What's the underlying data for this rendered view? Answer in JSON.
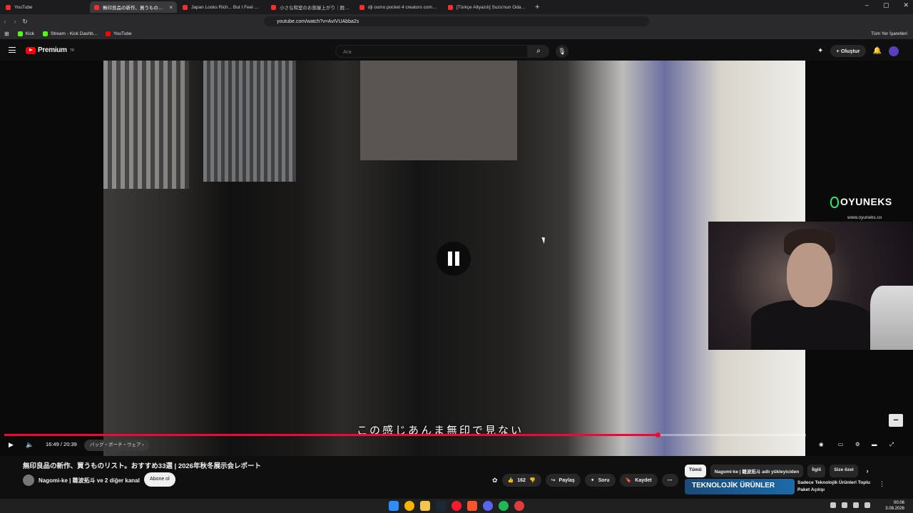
{
  "browser": {
    "tabs": [
      {
        "title": "YouTube",
        "active": false
      },
      {
        "title": "無印良品の新作、買うものリス",
        "active": true
      },
      {
        "title": "Japan Looks Rich... But I Feel Poor - ",
        "active": false
      },
      {
        "title": "小さな和室のお部屋上がり｜脱衣所が",
        "active": false
      },
      {
        "title": "dji osmo pocket 4 creators combo - ",
        "active": false
      },
      {
        "title": "[Türkçe Altyazılı] Suzu'nun Oda Turu",
        "active": false
      }
    ],
    "new_tab": "+",
    "url": "youtube.com/watch?v=AvIVUAbba2s",
    "bookmarks": [
      {
        "label": "Kick",
        "color": "#53fc18"
      },
      {
        "label": "Stream - Kick Dashb...",
        "color": "#53fc18"
      },
      {
        "label": "YouTube",
        "color": "#ff0000"
      }
    ],
    "all_bookmarks": "Tüm Yer İşaretleri",
    "window_controls": [
      "–",
      "▢",
      "✕"
    ]
  },
  "youtube": {
    "logo_text": "Premium",
    "logo_region": "TR",
    "search_placeholder": "Ara",
    "create_label": "Oluştur"
  },
  "player": {
    "subtitle": "この感じあんま無印で見ない",
    "current_time": "16:49",
    "duration": "20:39",
    "time_display": "16:49 / 20:39",
    "chapter": "バッグ・ポーチ・ウェア ›",
    "progress_fraction": 0.815,
    "overlay_brand": "OYUNEKS",
    "overlay_url": "www.oyuneks.co"
  },
  "video_info": {
    "title": "無印良品の新作、買うものリスト。おすすめ33選 | 2026年秋冬展示会レポート",
    "channel": "Nagomi-ke | 雛波拓斗 ve 2 diğer kanal",
    "subscribe": "Abone ol",
    "likes": "162",
    "share": "Paylaş",
    "ask": "Soru",
    "save": "Kaydet"
  },
  "sidebar": {
    "chips": [
      "Tümü",
      "Nagomi-ke | 雛波拓斗 adlı yükleyiciden",
      "İlgili",
      "Size özel"
    ],
    "rec_thumb_text": "TEKNOLOJİK ÜRÜNLER",
    "rec_title": "Sadece Teknolojik Ürünleri Toplu Paket Açılışı"
  },
  "taskbar": {
    "time": "00:06",
    "date": "3.08.2026"
  },
  "colors": {
    "accent": "#ff0033",
    "background": "#0f0f0f"
  }
}
